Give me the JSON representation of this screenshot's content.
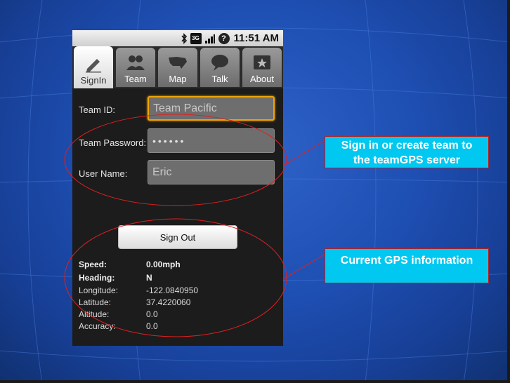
{
  "statusbar": {
    "network": "3G",
    "help": "?",
    "time": "11:51 AM"
  },
  "tabs": [
    {
      "label": "SignIn",
      "icon": "pencil-icon",
      "active": true
    },
    {
      "label": "Team",
      "icon": "people-icon",
      "active": false
    },
    {
      "label": "Map",
      "icon": "us-map-icon",
      "active": false
    },
    {
      "label": "Talk",
      "icon": "speech-bubble-icon",
      "active": false
    },
    {
      "label": "About",
      "icon": "star-icon",
      "active": false
    }
  ],
  "signin": {
    "team_id_label": "Team ID:",
    "team_id_value": "Team Pacific",
    "team_password_label": "Team Password:",
    "team_password_value": "••••••",
    "user_name_label": "User Name:",
    "user_name_value": "Eric",
    "sign_out_label": "Sign Out"
  },
  "gps": [
    {
      "key": "Speed:",
      "value": "0.00mph",
      "bold": true
    },
    {
      "key": "Heading:",
      "value": "N",
      "bold": true
    },
    {
      "key": "Longitude:",
      "value": "-122.0840950",
      "bold": false
    },
    {
      "key": "Latitude:",
      "value": "37.4220060",
      "bold": false
    },
    {
      "key": "Altitude:",
      "value": "0.0",
      "bold": false
    },
    {
      "key": "Accuracy:",
      "value": "0.0",
      "bold": false
    }
  ],
  "callouts": {
    "signin_line1": "Sign in or create team to",
    "signin_line2": "the teamGPS server",
    "gps_text": "Current GPS information"
  },
  "colors": {
    "background": "#1e4fb3",
    "callout": "#00c8f0",
    "callout_border": "#b22222",
    "focus": "#f2a300"
  }
}
